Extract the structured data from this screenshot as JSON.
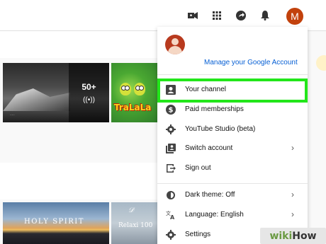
{
  "topbar": {
    "icons": [
      "video-camera-icon",
      "apps-grid-icon",
      "share-arrow-icon",
      "notification-bell-icon"
    ],
    "avatar_letter": "M",
    "avatar_color": "#c2410c"
  },
  "thumbnails": {
    "mountain": {
      "count": "50+"
    },
    "trala": {
      "text": "TraLaLa"
    },
    "holy": {
      "text": "HOLY SPIRIT"
    },
    "relax": {
      "text": "Relaxi 100"
    }
  },
  "account_menu": {
    "manage_link": "Manage your Google Account",
    "link_color": "#065fd4",
    "items": [
      {
        "label": "Your channel",
        "icon": "person-box-icon"
      },
      {
        "label": "Paid memberships",
        "icon": "dollar-circle-icon"
      },
      {
        "label": "YouTube Studio (beta)",
        "icon": "gear-icon"
      },
      {
        "label": "Switch account",
        "icon": "switch-account-icon",
        "submenu": true
      },
      {
        "label": "Sign out",
        "icon": "sign-out-icon"
      },
      {
        "label": "Dark theme: Off",
        "icon": "dark-theme-icon",
        "submenu": true
      },
      {
        "label": "Language: English",
        "icon": "translate-icon",
        "submenu": true
      },
      {
        "label": "Settings",
        "icon": "settings-gear-icon"
      }
    ],
    "highlight_color": "#22e61a"
  },
  "watermark": {
    "part1": "wiki",
    "part2": "How"
  }
}
